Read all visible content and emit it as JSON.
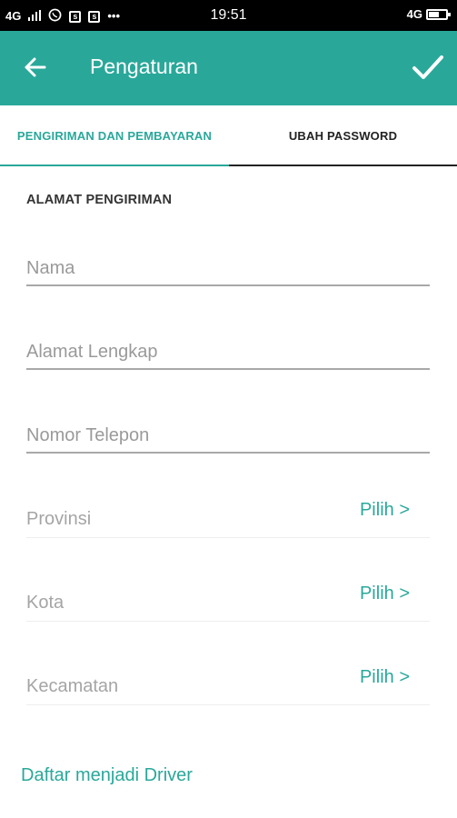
{
  "status_bar": {
    "network_left": "4G",
    "time": "19:51",
    "network_right": "4G",
    "battery_level": 0.6
  },
  "app_bar": {
    "title": "Pengaturan",
    "accent_color": "#29a89a"
  },
  "tabs": [
    {
      "label": "PENGIRIMAN DAN PEMBAYARAN",
      "active": true
    },
    {
      "label": "UBAH PASSWORD",
      "active": false
    }
  ],
  "section": {
    "title": "ALAMAT PENGIRIMAN"
  },
  "fields": {
    "nama": {
      "placeholder": "Nama",
      "value": ""
    },
    "alamat": {
      "placeholder": "Alamat Lengkap",
      "value": ""
    },
    "telepon": {
      "placeholder": "Nomor Telepon",
      "value": ""
    }
  },
  "pickers": [
    {
      "label": "Provinsi",
      "action": "Pilih >"
    },
    {
      "label": "Kota",
      "action": "Pilih >"
    },
    {
      "label": "Kecamatan",
      "action": "Pilih >"
    }
  ],
  "driver_link": "Daftar menjadi Driver"
}
